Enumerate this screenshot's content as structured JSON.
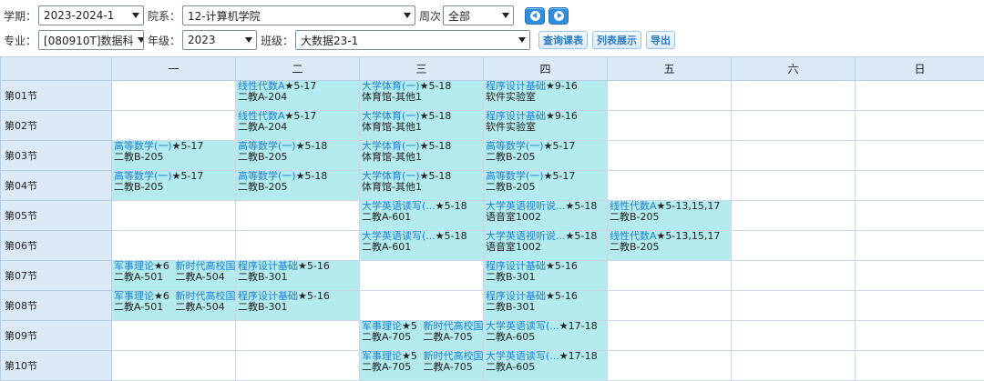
{
  "filters": {
    "term_label": "学期：",
    "term_value": "2023-2024-1",
    "dept_label": "院系：",
    "dept_value": "12-计算机学院",
    "week_label": "周次",
    "week_value": "全部",
    "major_label": "专业：",
    "major_value": "[080910T]数据科",
    "grade_label": "年级：",
    "grade_value": "2023",
    "class_label": "班级：",
    "class_value": "大数据23-1",
    "query_btn": "查询课表",
    "list_btn": "列表展示",
    "export_btn": "导出"
  },
  "days": [
    "一",
    "二",
    "三",
    "四",
    "五",
    "六",
    "日"
  ],
  "sections": [
    "第01节",
    "第02节",
    "第03节",
    "第04节",
    "第05节",
    "第06节",
    "第07节",
    "第08节",
    "第09节",
    "第10节"
  ],
  "courses": {
    "xxds": {
      "name": "线性代数A",
      "weeks": "★5-17",
      "room": "二教A-204"
    },
    "tyl": {
      "name": "大学体育(一)",
      "weeks": "★5-18",
      "room": "体育馆-其他1"
    },
    "cxsj_a": {
      "name": "程序设计基础",
      "weeks": "★9-16",
      "room": "软件实验室"
    },
    "gs1_mon": {
      "name": "高等数学(一)",
      "weeks": "★5-17",
      "room": "二教B-205"
    },
    "gs1_tue": {
      "name": "高等数学(一)",
      "weeks": "★5-18",
      "room": "二教B-205"
    },
    "gs1_thu": {
      "name": "高等数学(一)",
      "weeks": "★5-17",
      "room": "二教B-205"
    },
    "yy_wed": {
      "name": "大学英语读写(...",
      "weeks": "★5-18",
      "room": "二教A-601"
    },
    "yy_thu": {
      "name": "大学英语视听说...",
      "weeks": "★5-18",
      "room": "语音室1002"
    },
    "xxds_fri": {
      "name": "线性代数A",
      "weeks": "★5-13,15,17",
      "room": "二教B-205"
    },
    "jslr_mon": {
      "name": "军事理论",
      "weeks": "★6",
      "room": "二教A-501"
    },
    "xsd_mon": {
      "name": "新时代高校国",
      "weeks": "",
      "room": "二教A-504"
    },
    "cxsj_tue": {
      "name": "程序设计基础",
      "weeks": "★5-16",
      "room": "二教B-301"
    },
    "cxsj_thu": {
      "name": "程序设计基础",
      "weeks": "★5-16",
      "room": "二教B-301"
    },
    "jslr_wed": {
      "name": "军事理论",
      "weeks": "★5",
      "room": "二教A-705"
    },
    "xsd_wed": {
      "name": "新时代高校国",
      "weeks": "",
      "room": "二教A-705"
    },
    "yy_thu2": {
      "name": "大学英语读写(...",
      "weeks": "★17-18",
      "room": "二教A-605"
    }
  }
}
